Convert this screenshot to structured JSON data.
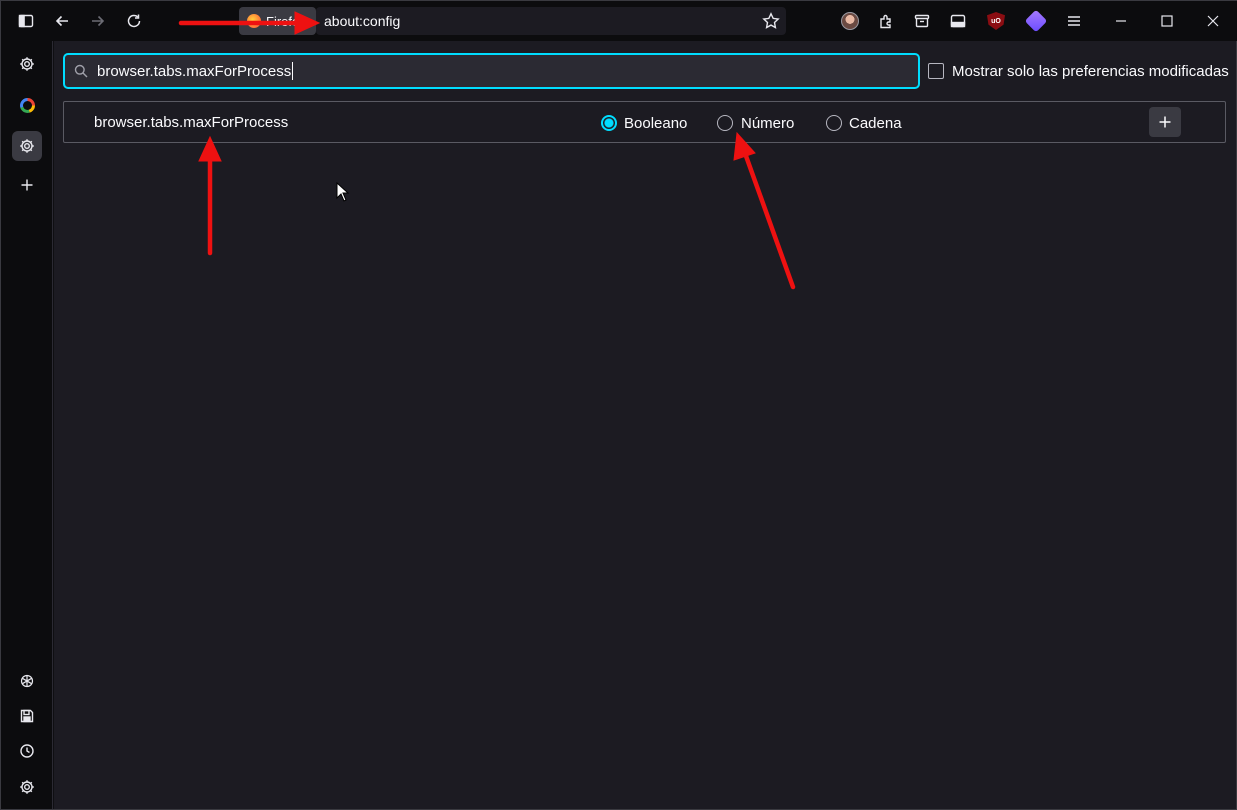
{
  "toolbar": {
    "tab_label": "Firefox",
    "url": "about:config",
    "icons": [
      "sidebar-icon",
      "back-icon",
      "forward-icon",
      "reload-icon",
      "bookmark-star-icon",
      "account-avatar-icon",
      "extensions-icon",
      "pocket-icon",
      "reader-view-icon",
      "ublock-icon",
      "gem-extension-icon",
      "menu-icon",
      "minimize-icon",
      "maximize-icon",
      "close-icon"
    ]
  },
  "sidebar": {
    "icons": [
      "settings-icon",
      "google-icon",
      "settings-icon-active",
      "add-icon",
      "chatgpt-icon",
      "save-icon",
      "history-icon",
      "gear-icon"
    ]
  },
  "search": {
    "value": "browser.tabs.maxForProcess",
    "modified_only_label": "Mostrar solo las preferencias modificadas"
  },
  "pref_row": {
    "name": "browser.tabs.maxForProcess",
    "types": [
      {
        "label": "Booleano",
        "checked": true
      },
      {
        "label": "Número",
        "checked": false
      },
      {
        "label": "Cadena",
        "checked": false
      }
    ],
    "add_label": "+"
  },
  "colors": {
    "accent": "#00ddff",
    "annotation_arrow": "#ee1111",
    "background": "#1c1b22"
  }
}
